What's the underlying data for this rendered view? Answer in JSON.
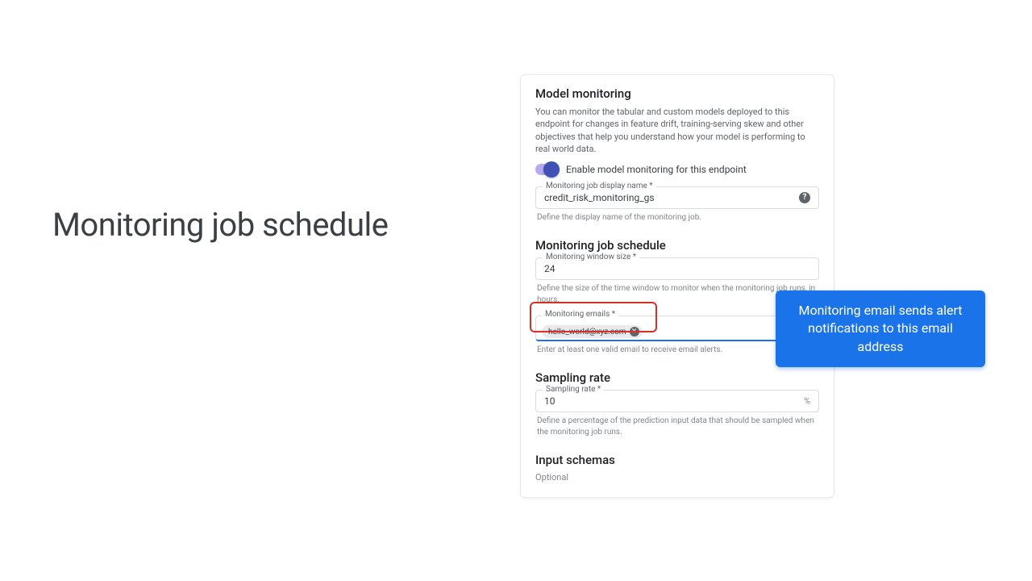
{
  "left": {
    "title": "Monitoring job schedule"
  },
  "panel": {
    "heading": "Model monitoring",
    "intro": "You can monitor the tabular and custom models deployed to this endpoint for changes in feature drift, training-serving skew and other objectives that help you understand how your model is performing to real world data.",
    "toggle_label": "Enable model monitoring for this endpoint",
    "display_name": {
      "label": "Monitoring job display name *",
      "value": "credit_risk_monitoring_gs",
      "helper": "Define the display name of the monitoring job."
    },
    "schedule": {
      "heading": "Monitoring job schedule",
      "window": {
        "label": "Monitoring window size *",
        "value": "24",
        "helper": "Define the size of the time window to monitor when the monitoring job runs, in hours."
      },
      "emails": {
        "label": "Monitoring emails *",
        "chip": "hello_world@xyz.com",
        "helper": "Enter at least one valid email to receive email alerts."
      }
    },
    "sampling": {
      "heading": "Sampling rate",
      "rate": {
        "label": "Sampling rate *",
        "value": "10",
        "suffix": "%",
        "helper": "Define a percentage of the prediction input data that should be sampled when the monitoring job runs."
      }
    },
    "input_schemas": {
      "heading": "Input schemas",
      "optional": "Optional"
    }
  },
  "callout": {
    "text": "Monitoring email sends alert notifications to this email address"
  }
}
